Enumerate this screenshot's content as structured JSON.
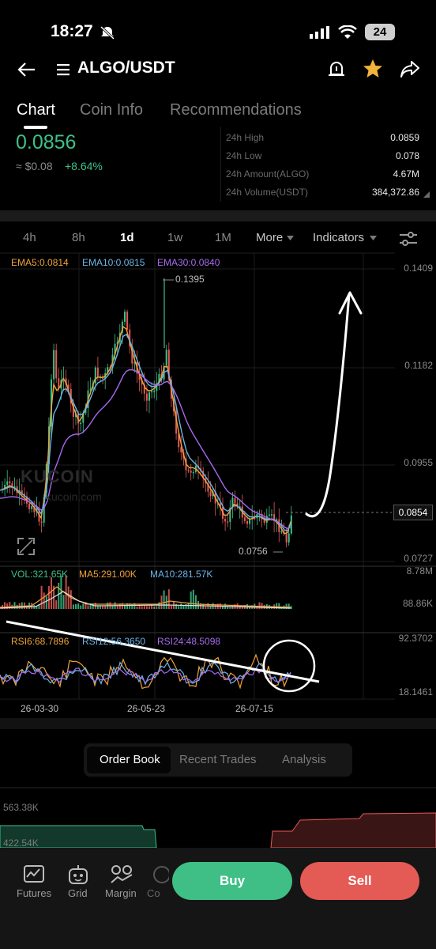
{
  "status": {
    "time": "18:27",
    "battery": "24"
  },
  "header": {
    "pair": "ALGO/USDT"
  },
  "tabs": [
    "Chart",
    "Coin Info",
    "Recommendations"
  ],
  "ticker": {
    "price": "0.0856",
    "fiat": "≈ $0.08",
    "change": "+8.64%",
    "stats": [
      {
        "label": "24h High",
        "value": "0.0859"
      },
      {
        "label": "24h Low",
        "value": "0.078"
      },
      {
        "label": "24h Amount(ALGO)",
        "value": "4.67M"
      },
      {
        "label": "24h Volume(USDT)",
        "value": "384,372.86"
      }
    ]
  },
  "timeframes": {
    "items": [
      "4h",
      "8h",
      "1d",
      "1w",
      "1M"
    ],
    "active": "1d",
    "more": "More",
    "indicators": "Indicators"
  },
  "indicators": {
    "ema5": "EMA5:0.0814",
    "ema10": "EMA10:0.0815",
    "ema30": "EMA30:0.0840",
    "vol": "VOL:321.65K",
    "ma5": "MA5:291.00K",
    "ma10": "MA10:281.57K",
    "rsi6": "RSI6:68.7896",
    "rsi12": "RSI12:56.3650",
    "rsi24": "RSI24:48.5098"
  },
  "chart_data": {
    "type": "candlestick",
    "y_axis_ticks": [
      "0.1409",
      "0.1182",
      "0.0955",
      "0.0727"
    ],
    "current_price_label": "0.0854",
    "high_marker": "0.1395",
    "low_marker": "0.0756",
    "volume_axis": [
      "8.78M",
      "88.86K"
    ],
    "rsi_axis": [
      "92.3702",
      "18.1461"
    ],
    "x_labels": [
      "26-03-30",
      "26-05-23",
      "26-07-15"
    ],
    "watermark": "KUCOIN",
    "watermark_url": "kucoin.com",
    "colors": {
      "up": "#3ec08a",
      "down": "#e45a55",
      "ema5": "#f0a33a",
      "ema10": "#6db4e8",
      "ema30": "#a66bf0"
    }
  },
  "orderbook": {
    "tabs": [
      "Order Book",
      "Recent Trades",
      "Analysis"
    ],
    "active": "Order Book",
    "depth_labels": [
      "563.38K",
      "422.54K"
    ]
  },
  "bottom_nav": {
    "items": [
      "Futures",
      "Grid",
      "Margin",
      "Co"
    ],
    "buy": "Buy",
    "sell": "Sell"
  }
}
